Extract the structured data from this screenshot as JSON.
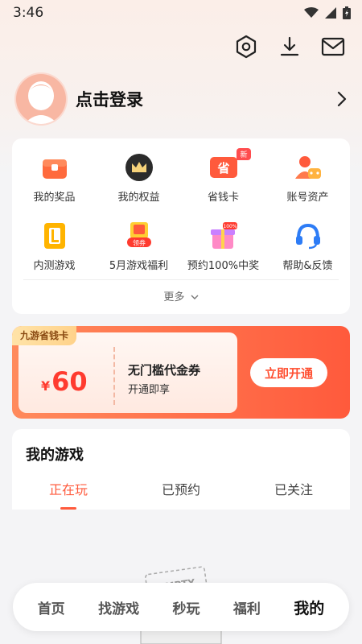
{
  "status_bar": {
    "time": "3:46"
  },
  "header": {
    "login_text": "点击登录",
    "actions": [
      "hexagon-settings-icon",
      "download-icon",
      "mail-icon"
    ]
  },
  "menu": {
    "items": [
      {
        "label": "我的奖品",
        "icon": "prize-chest-icon"
      },
      {
        "label": "我的权益",
        "icon": "crown-icon"
      },
      {
        "label": "省钱卡",
        "icon": "save-money-card-icon",
        "badge": "新"
      },
      {
        "label": "账号资产",
        "icon": "account-assets-icon"
      },
      {
        "label": "内测游戏",
        "icon": "beta-game-icon"
      },
      {
        "label": "5月游戏福利",
        "icon": "coupon-gift-icon",
        "badge": "领券"
      },
      {
        "label": "预约100%中奖",
        "icon": "gift-box-icon",
        "badge": "100%"
      },
      {
        "label": "帮助&反馈",
        "icon": "headset-icon"
      }
    ],
    "more_label": "更多"
  },
  "coupon": {
    "tag": "九游省钱卡",
    "currency": "¥",
    "amount": "60",
    "title": "无门槛代金券",
    "subtitle": "开通即享",
    "button": "立即开通"
  },
  "games": {
    "title": "我的游戏",
    "tabs": [
      "正在玩",
      "已预约",
      "已关注"
    ],
    "active_tab": 0
  },
  "empty_illustration_text": "EMPTY",
  "bottom_nav": {
    "items": [
      "首页",
      "找游戏",
      "秒玩",
      "福利",
      "我的"
    ],
    "active": 4
  },
  "colors": {
    "accent": "#ff5a3c"
  }
}
